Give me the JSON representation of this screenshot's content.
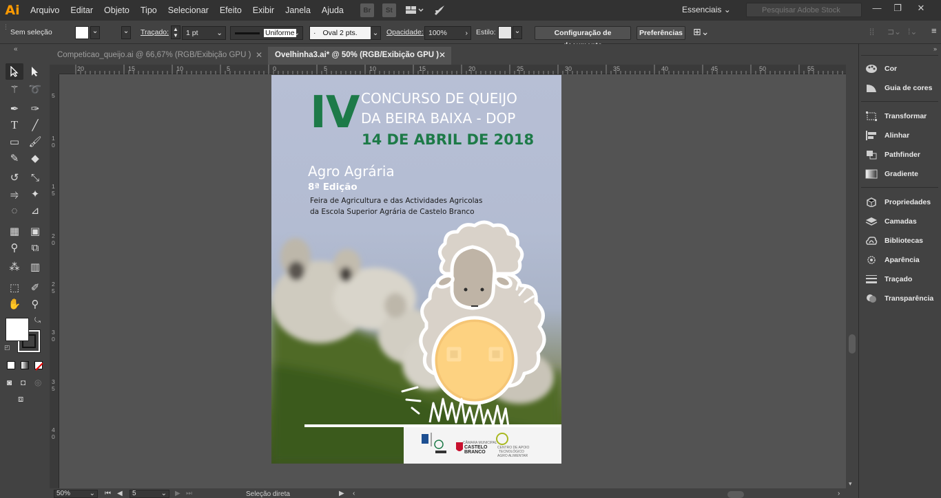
{
  "app": {
    "logo": "Ai",
    "menu": [
      "Arquivo",
      "Editar",
      "Objeto",
      "Tipo",
      "Selecionar",
      "Efeito",
      "Exibir",
      "Janela",
      "Ajuda"
    ],
    "bridge_labels": [
      "Br",
      "St"
    ],
    "workspace": "Essenciais",
    "stock_placeholder": "Pesquisar Adobe Stock",
    "window_buttons": [
      "—",
      "❐",
      "✕"
    ]
  },
  "control": {
    "selection": "Sem seleção",
    "stroke_label": "Traçado:",
    "stroke_value": "1 pt",
    "profile_label": "Uniforme",
    "brush_label": "Oval 2 pts.",
    "opacity_label": "Opacidade:",
    "opacity_value": "100%",
    "style_label": "Estilo:",
    "doc_config_button": "Configuração de documento",
    "prefs_button": "Preferências"
  },
  "tabs": [
    {
      "title": "Competicao_queijo.ai @ 66,67% (RGB/Exibição GPU )",
      "active": false
    },
    {
      "title": "Ovelhinha3.ai* @ 50% (RGB/Exibição GPU )",
      "active": true
    }
  ],
  "ruler": {
    "top_labels": [
      "20",
      "15",
      "10",
      "5",
      "0",
      "5",
      "10",
      "15",
      "20",
      "25",
      "30",
      "35",
      "40",
      "45",
      "50",
      "55"
    ],
    "left_labels": [
      "5",
      "1\n0",
      "1\n5",
      "2\n0",
      "2\n5",
      "3\n0",
      "3\n5",
      "4\n0"
    ]
  },
  "poster": {
    "big_numeral": "IV",
    "title_line1": "CONCURSO DE QUEIJO",
    "title_line2": "DA BEIRA BAIXA - DOP",
    "date": "14 DE ABRIL DE 2018",
    "event_name": "Agro Agrária",
    "edition": "8ª Edição",
    "desc_line1": "Feira  de Agricultura e das Actividades Agricolas",
    "desc_line2": "da Escola Superior Agrária de Castelo Branco",
    "logo_castelo_line1": "CASTELO",
    "logo_castelo_line2": "BRANCO",
    "logo_castelo_small": "CÂMARA MUNICIPAL",
    "logo_centro_line1": "CENTRO DE APOIO",
    "logo_centro_line2": "TECNOLÓGICO",
    "logo_centro_line3": "AGRO ALIMENTAR"
  },
  "panels": [
    {
      "label": "Cor",
      "icon": "palette-icon"
    },
    {
      "label": "Guia de cores",
      "icon": "color-guide-icon"
    },
    {
      "label": "Transformar",
      "icon": "transform-icon"
    },
    {
      "label": "Alinhar",
      "icon": "align-icon"
    },
    {
      "label": "Pathfinder",
      "icon": "pathfinder-icon"
    },
    {
      "label": "Gradiente",
      "icon": "gradient-icon"
    },
    {
      "label": "Propriedades",
      "icon": "properties-icon"
    },
    {
      "label": "Camadas",
      "icon": "layers-icon"
    },
    {
      "label": "Bibliotecas",
      "icon": "libraries-icon"
    },
    {
      "label": "Aparência",
      "icon": "appearance-icon"
    },
    {
      "label": "Traçado",
      "icon": "stroke-icon"
    },
    {
      "label": "Transparência",
      "icon": "transparency-icon"
    }
  ],
  "status": {
    "zoom": "50%",
    "artboard_number": "5",
    "tool_status": "Seleção direta"
  },
  "colors": {
    "accent_green": "#1d7a48",
    "ai_orange": "#ff9a00"
  }
}
